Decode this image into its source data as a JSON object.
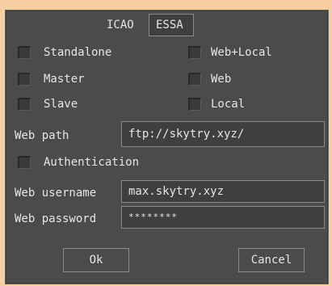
{
  "icao": {
    "label": "ICAO",
    "value": "ESSA"
  },
  "modes": [
    {
      "label": "Standalone",
      "checked": false
    },
    {
      "label": "Master",
      "checked": false
    },
    {
      "label": "Slave",
      "checked": false
    }
  ],
  "targets": [
    {
      "label": "Web+Local",
      "checked": false
    },
    {
      "label": "Web",
      "checked": false
    },
    {
      "label": "Local",
      "checked": false
    }
  ],
  "web_path": {
    "label": "Web path",
    "value": "ftp://skytry.xyz/"
  },
  "authentication": {
    "label": "Authentication",
    "checked": false
  },
  "web_username": {
    "label": "Web username",
    "value": "max.skytry.xyz"
  },
  "web_password": {
    "label": "Web password",
    "value": "********"
  },
  "buttons": {
    "ok": "Ok",
    "cancel": "Cancel"
  },
  "colors": {
    "background": "#f7cfa0",
    "dialog": "#4b4b4b",
    "field": "#3f3f3f",
    "border": "#8a8a8a",
    "text": "#e6e6e6"
  }
}
